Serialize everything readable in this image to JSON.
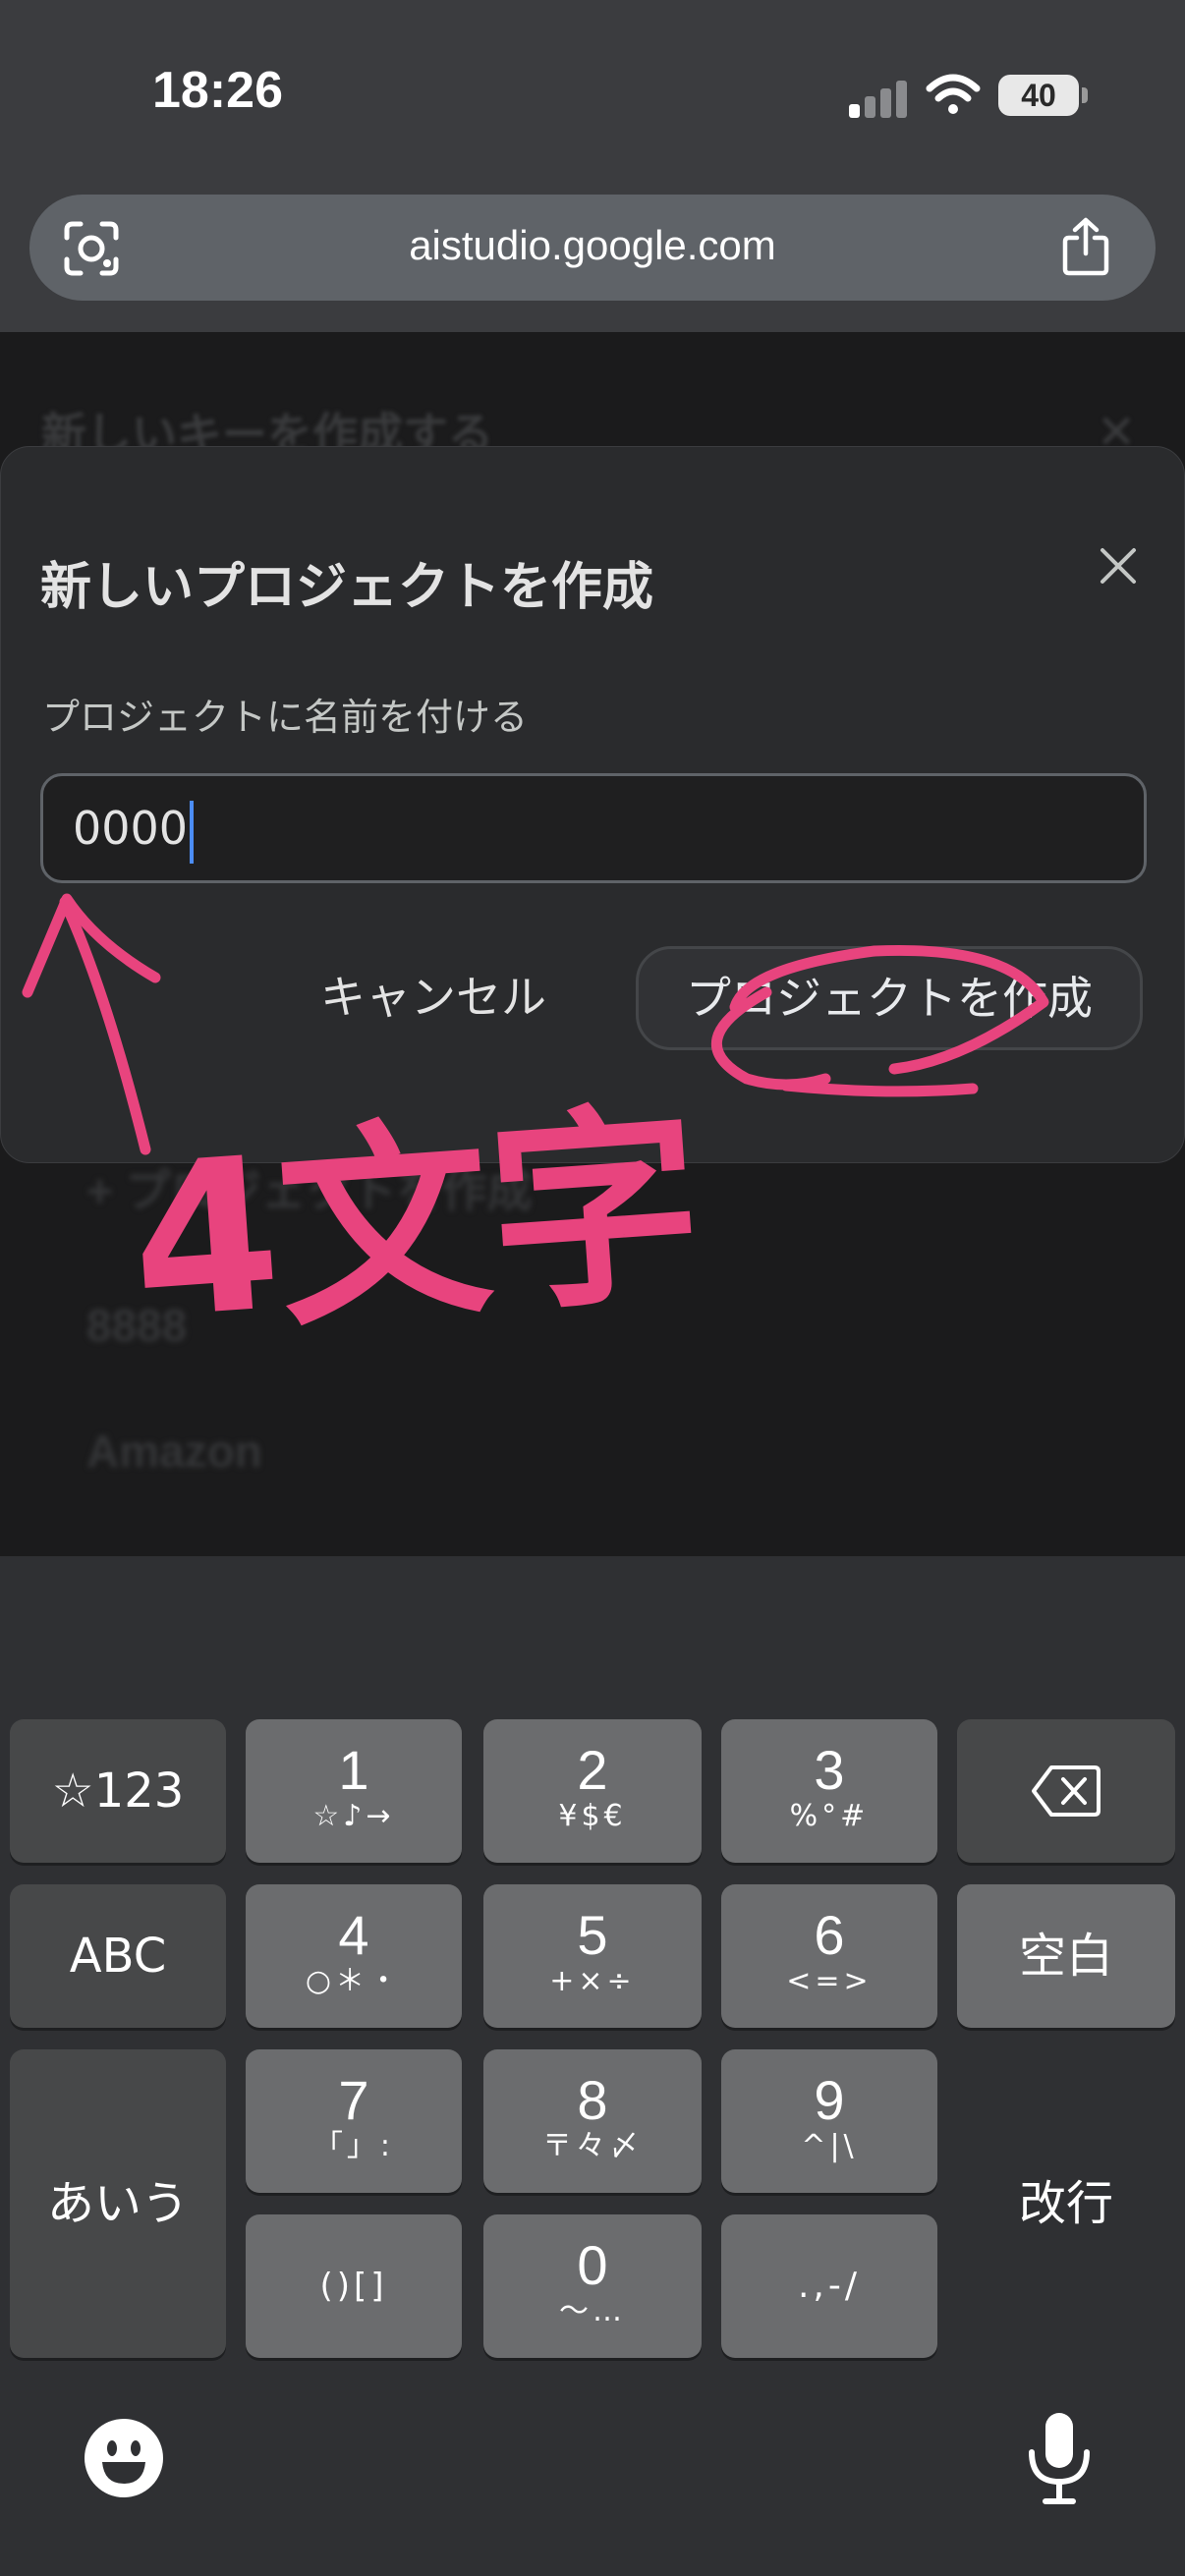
{
  "status_bar": {
    "time": "18:26",
    "battery": "40"
  },
  "browser": {
    "url": "aistudio.google.com"
  },
  "background_page": {
    "title": "新しいキーを作成する",
    "items": [
      "+ プロジェクトを作成",
      "8888",
      "Amazon"
    ]
  },
  "dialog": {
    "title": "新しいプロジェクトを作成",
    "field_label": "プロジェクトに名前を付ける",
    "input_value": "0000",
    "cancel_label": "キャンセル",
    "create_label": "プロジェクトを作成"
  },
  "annotation": {
    "text": "4文字"
  },
  "keyboard": {
    "k_symbols": "☆123",
    "k1_main": "1",
    "k1_sub": "☆♪→",
    "k2_main": "2",
    "k2_sub": "¥$€",
    "k3_main": "3",
    "k3_sub": "%°#",
    "k_abc": "ABC",
    "k4_main": "4",
    "k4_sub": "○＊・",
    "k5_main": "5",
    "k5_sub": "+×÷",
    "k6_main": "6",
    "k6_sub": "<=>",
    "k_space": "空白",
    "k_kana": "あいう",
    "k7_main": "7",
    "k7_sub": "「」:",
    "k8_main": "8",
    "k8_sub": "〒々〆",
    "k9_main": "9",
    "k9_sub": "^|\\",
    "k_return": "改行",
    "k_paren": "()[]",
    "k0_main": "0",
    "k0_sub": "〜…",
    "k_punct": ".,-/"
  }
}
